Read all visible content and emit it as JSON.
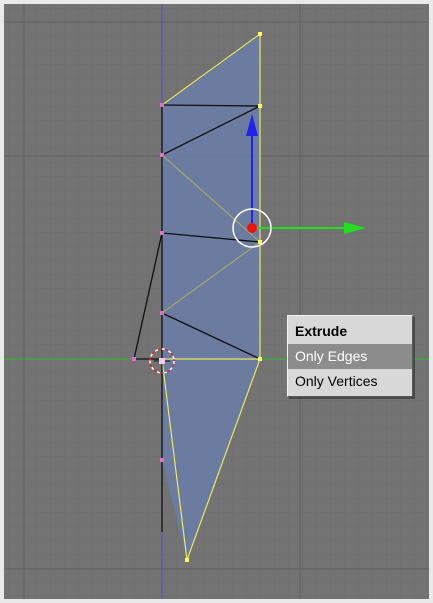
{
  "viewport": {
    "background_color": "#737373",
    "grid_color": "#6a6a6a",
    "x_axis_color": "#2fbf2f",
    "y_axis_color": "#4f4fd0",
    "selected_edge_color": "#f0f05a",
    "face_fill_color": "#6b7da8",
    "manipulator_x_color": "#22dd22",
    "manipulator_z_color": "#2222ee"
  },
  "extrude_menu": {
    "title": "Extrude",
    "items": [
      {
        "label": "Only Edges",
        "selected": true
      },
      {
        "label": "Only Vertices",
        "selected": false
      }
    ]
  }
}
